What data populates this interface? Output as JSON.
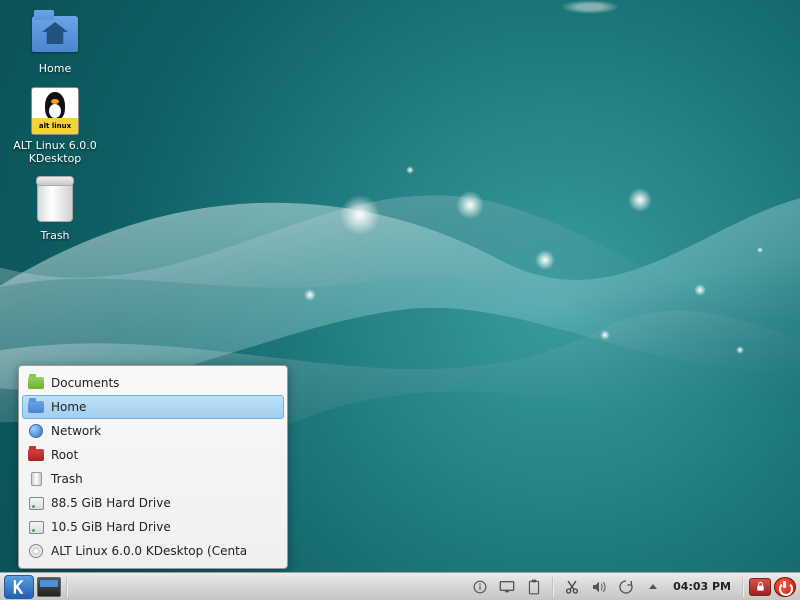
{
  "desktop_icons": {
    "home": "Home",
    "alt_linux": "ALT Linux 6.0.0 KDesktop",
    "alt_linux_banner": "alt linux",
    "trash": "Trash"
  },
  "places_menu": {
    "items": [
      {
        "label": "Documents",
        "icon": "folder-green",
        "selected": false
      },
      {
        "label": "Home",
        "icon": "folder-blue",
        "selected": true
      },
      {
        "label": "Network",
        "icon": "globe",
        "selected": false
      },
      {
        "label": "Root",
        "icon": "folder-red",
        "selected": false
      },
      {
        "label": "Trash",
        "icon": "trash",
        "selected": false
      },
      {
        "label": "88.5 GiB Hard Drive",
        "icon": "hdd",
        "selected": false
      },
      {
        "label": "10.5 GiB Hard Drive",
        "icon": "hdd",
        "selected": false
      },
      {
        "label": "ALT Linux 6.0.0 KDesktop  (Centa",
        "icon": "disc",
        "selected": false
      }
    ]
  },
  "taskbar": {
    "clock": "04:03 PM"
  }
}
